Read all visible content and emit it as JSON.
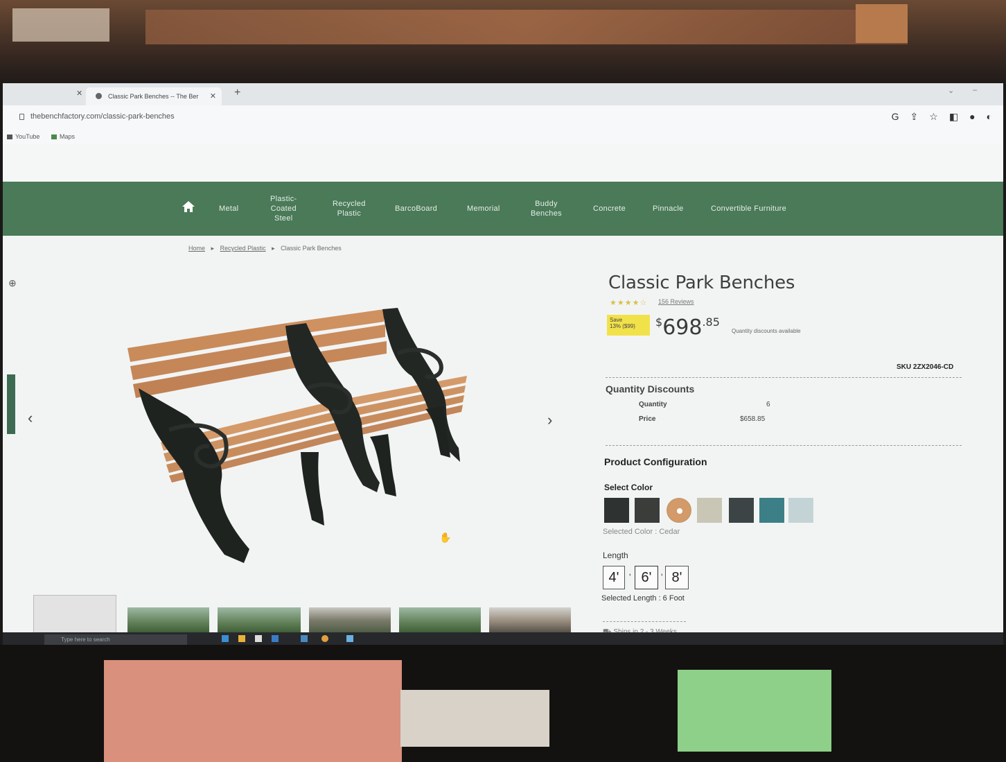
{
  "browser": {
    "tab_title": "Classic Park Benches -- The Ber",
    "url": "thebenchfactory.com/classic-park-benches",
    "bookmarks": [
      "YouTube",
      "Maps"
    ]
  },
  "nav": {
    "items": [
      {
        "label": "Metal"
      },
      {
        "label": "Plastic-\nCoated\nSteel"
      },
      {
        "label": "Recycled\nPlastic"
      },
      {
        "label": "BarcoBoard"
      },
      {
        "label": "Memorial"
      },
      {
        "label": "Buddy\nBenches"
      },
      {
        "label": "Concrete"
      },
      {
        "label": "Pinnacle"
      },
      {
        "label": "Convertible Furniture"
      }
    ]
  },
  "breadcrumb": {
    "home": "Home",
    "category": "Recycled Plastic",
    "current": "Classic Park Benches"
  },
  "product": {
    "title": "Classic Park Benches",
    "rating": 4.5,
    "stars": "★★★★☆",
    "reviews": "156 Reviews",
    "save_line1": "Save",
    "save_line2": "13% ($99)",
    "price_dollar": "$",
    "price_main": "698",
    "price_cents": ".85",
    "price_note": "Quantity discounts available",
    "sku": "SKU 2ZX2046-CD"
  },
  "quantity_discounts": {
    "title": "Quantity Discounts",
    "quantity_label": "Quantity",
    "quantity_value": "6",
    "price_label": "Price",
    "price_value": "$658.85"
  },
  "configuration": {
    "title": "Product Configuration",
    "select_color_label": "Select Color",
    "swatches": [
      {
        "color": "#2e3230"
      },
      {
        "color": "#3b3d3b"
      },
      {
        "color": "#d49a6a",
        "selected": true
      },
      {
        "color": "#c9c6b6"
      },
      {
        "color": "#3d4445"
      },
      {
        "color": "#3c7f86"
      },
      {
        "color": "#c4d4d6"
      }
    ],
    "selected_color": "Selected Color : Cedar",
    "length_label": "Length",
    "lengths": [
      "4'",
      "6'",
      "8'"
    ],
    "selected_length": "Selected Length : 6 Foot",
    "ships": "Ships in 2 - 3 Weeks"
  },
  "taskbar": {
    "search_placeholder": "Type here to search"
  },
  "colors": {
    "nav_green": "#4a7a58",
    "save_yellow": "#f2e24a"
  }
}
